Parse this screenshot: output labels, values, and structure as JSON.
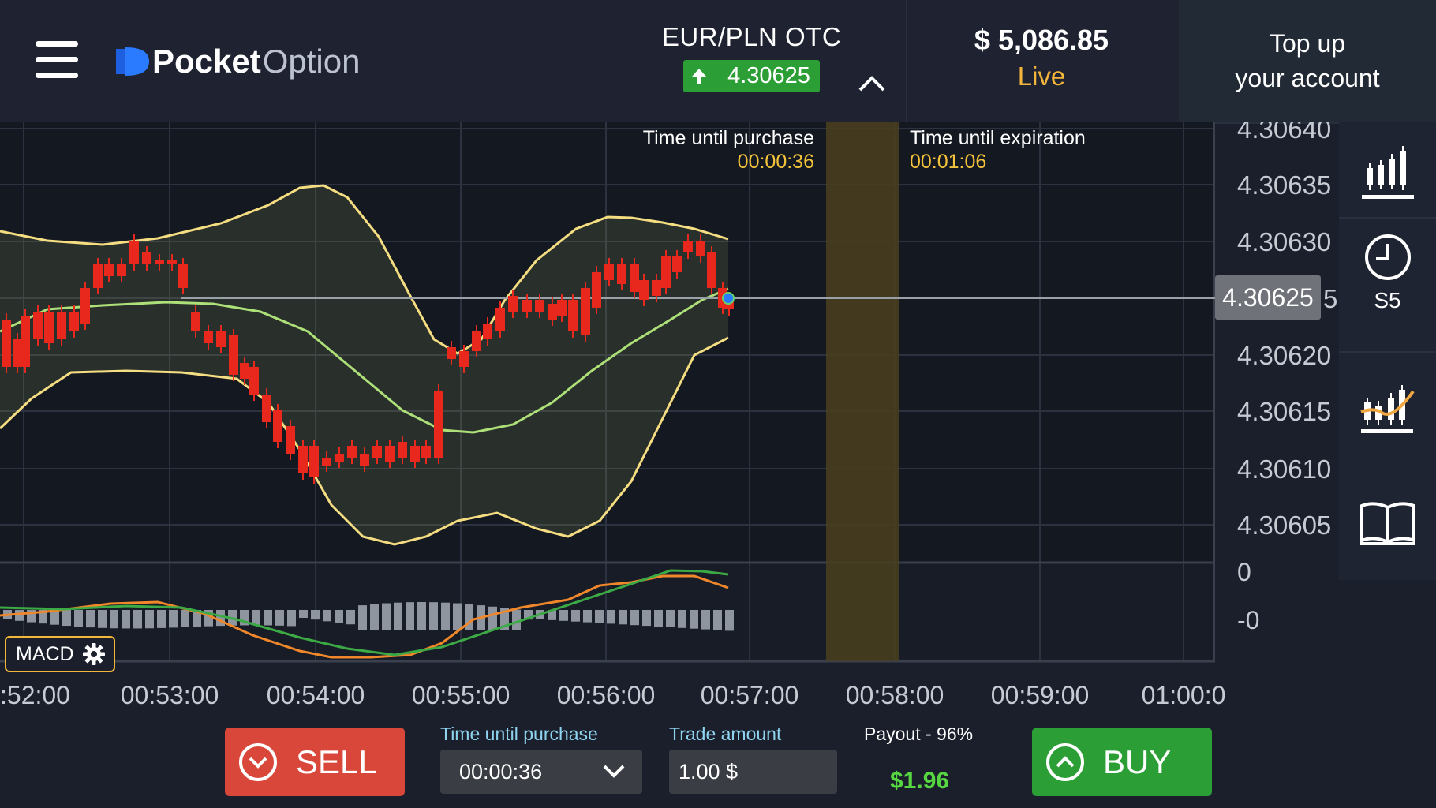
{
  "header": {
    "logo_bold": "Pocket",
    "logo_light": "Option",
    "pair_name": "EUR/PLN OTC",
    "pair_price": "4.30625",
    "balance": "$ 5,086.85",
    "account_mode": "Live",
    "topup_line1": "Top up",
    "topup_line2": "your account"
  },
  "chart": {
    "time_until_purchase_label": "Time until purchase",
    "time_until_purchase_value": "00:00:36",
    "time_until_expiration_label": "Time until expiration",
    "time_until_expiration_value": "00:01:06",
    "current_price": "4.30625",
    "y_ticks": [
      "4.30640",
      "4.30635",
      "4.30630",
      "5",
      "4.30620",
      "4.30615",
      "4.30610",
      "4.30605"
    ],
    "macd_ticks": [
      "0",
      "-0"
    ],
    "x_ticks": [
      ":52:00",
      "00:53:00",
      "00:54:00",
      "00:55:00",
      "00:56:00",
      "00:57:00",
      "00:58:00",
      "00:59:00",
      "01:00:0"
    ],
    "macd_label": "MACD",
    "colors": {
      "up": "#22c12e",
      "down": "#e8281c",
      "band": "#f5dd82",
      "middle": "#aee079",
      "macd_line": "#f0882b",
      "signal_line": "#3cab45"
    }
  },
  "toolbar": {
    "timeframe_label": "S5",
    "icons": [
      "candles-chart-icon",
      "clock-icon",
      "indicators-icon",
      "book-icon"
    ]
  },
  "trade": {
    "sell_label": "SELL",
    "buy_label": "BUY",
    "time_label": "Time until purchase",
    "time_value": "00:00:36",
    "amount_label": "Trade amount",
    "amount_value": "1.00 $",
    "payout_label": "Payout - 96%",
    "payout_value": "$1.96"
  }
}
